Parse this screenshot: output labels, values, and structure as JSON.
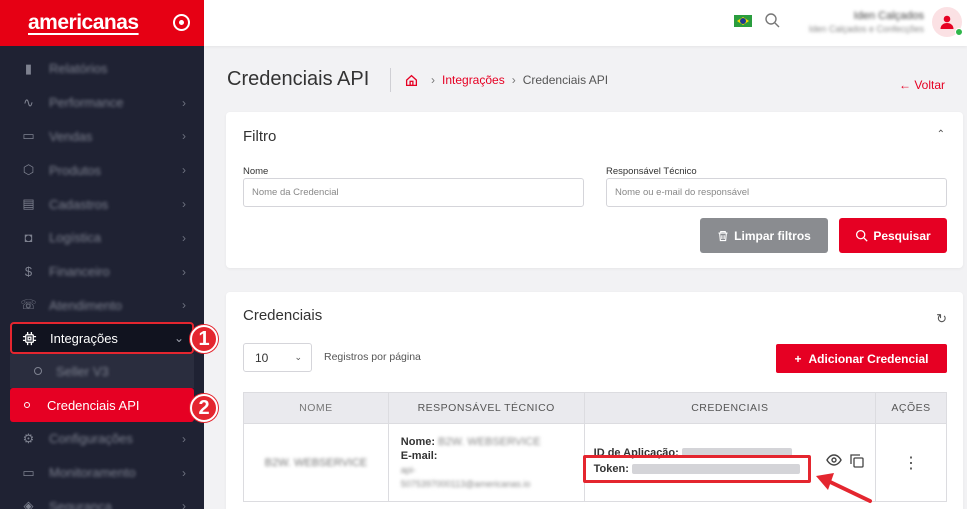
{
  "sidebar": {
    "brand": "americanas",
    "items": [
      {
        "label": "Relatórios",
        "icon": "bar-chart-icon",
        "chev": false
      },
      {
        "label": "Performance",
        "icon": "pulse-icon",
        "chev": true
      },
      {
        "label": "Vendas",
        "icon": "wallet-icon",
        "chev": true
      },
      {
        "label": "Produtos",
        "icon": "box-icon",
        "chev": true
      },
      {
        "label": "Cadastros",
        "icon": "folder-icon",
        "chev": true
      },
      {
        "label": "Logística",
        "icon": "truck-icon",
        "chev": true
      },
      {
        "label": "Financeiro",
        "icon": "dollar-icon",
        "chev": true
      },
      {
        "label": "Atendimento",
        "icon": "headset-icon",
        "chev": true
      }
    ],
    "integracoes": {
      "label": "Integrações",
      "icon": "chip-icon"
    },
    "sub_items": [
      {
        "label": "Seller V3"
      },
      {
        "label": "Credenciais API"
      }
    ],
    "bottom_items": [
      {
        "label": "Configurações",
        "icon": "gear-icon"
      },
      {
        "label": "Monitoramento",
        "icon": "monitor-icon"
      },
      {
        "label": "Segurança",
        "icon": "shield-icon"
      }
    ]
  },
  "badges": {
    "one": "1",
    "two": "2"
  },
  "topbar": {
    "user_name": "Iden Calçados",
    "user_sub": "Iden Calçados e Confecções"
  },
  "page": {
    "title": "Credenciais API",
    "breadcrumb_link": "Integrações",
    "breadcrumb_current": "Credenciais API",
    "back": "Voltar"
  },
  "filter": {
    "title": "Filtro",
    "name_label": "Nome",
    "name_placeholder": "Nome da Credencial",
    "resp_label": "Responsável Técnico",
    "resp_placeholder": "Nome ou e-mail do responsável",
    "clear_btn": "Limpar filtros",
    "search_btn": "Pesquisar"
  },
  "credentials": {
    "title": "Credenciais",
    "per_page": "10",
    "per_page_label": "Registros por página",
    "add_btn": "Adicionar Credencial",
    "columns": [
      "NOME",
      "RESPONSÁVEL TÉCNICO",
      "CREDENCIAIS",
      "AÇÕES"
    ],
    "row": {
      "name": "B2W. WEBSERVICE",
      "resp_name_label": "Nome:",
      "resp_name_value": "B2W. WEBSERVICE",
      "resp_email_label": "E-mail:",
      "resp_email_value": "api-",
      "resp_email_value2": "5075397000113@americanas.io",
      "id_label": "ID de Aplicação:",
      "token_label": "Token:"
    }
  }
}
